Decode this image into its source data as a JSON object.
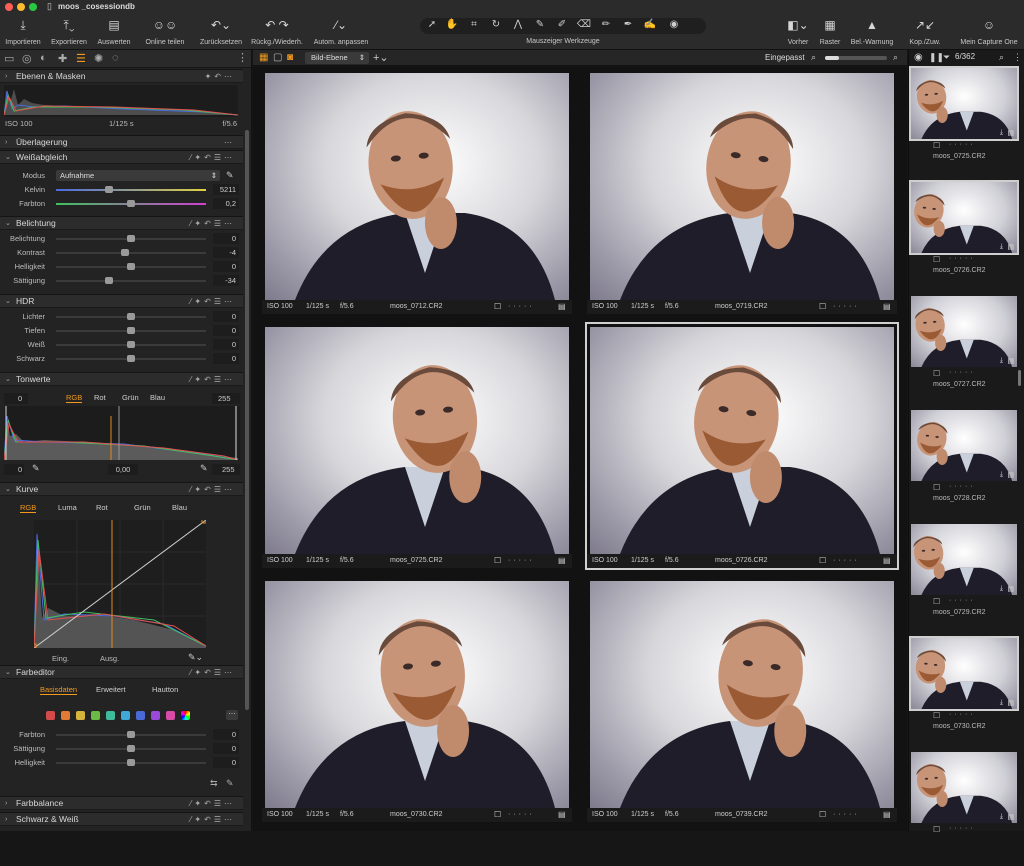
{
  "window": {
    "title": "moos _cosessiondb"
  },
  "toolbar": {
    "import": "Importieren",
    "export": "Exportieren",
    "evaluate": "Auswerten",
    "share": "Online teilen",
    "reset": "Zurücksetzen",
    "undo": "Rückg./Wiederh.",
    "auto": "Autom. anpassen",
    "cursor_tools": "Mauszeiger Werkzeuge",
    "before": "Vorher",
    "grid": "Raster",
    "exposure_warning": "Bel.-Warnung",
    "copy": "Kop./Zuw.",
    "my_capture": "Mein Capture One"
  },
  "left": {
    "layers": {
      "title": "Ebenen & Masken"
    },
    "histogram": {
      "iso": "ISO 100",
      "shutter": "1/125 s",
      "aperture": "f/5.6"
    },
    "overlay": {
      "title": "Überlagerung"
    },
    "wb": {
      "title": "Weißabgleich",
      "mode_label": "Modus",
      "mode_value": "Aufnahme",
      "kelvin_label": "Kelvin",
      "kelvin_value": "5211",
      "tint_label": "Farbton",
      "tint_value": "0,2",
      "kelvin_pos": 0.35,
      "tint_pos": 0.5
    },
    "exposure": {
      "title": "Belichtung",
      "rows": [
        {
          "label": "Belichtung",
          "value": "0",
          "pos": 0.5
        },
        {
          "label": "Kontrast",
          "value": "-4",
          "pos": 0.46
        },
        {
          "label": "Helligkeit",
          "value": "0",
          "pos": 0.5
        },
        {
          "label": "Sättigung",
          "value": "-34",
          "pos": 0.35
        }
      ]
    },
    "hdr": {
      "title": "HDR",
      "rows": [
        {
          "label": "Lichter",
          "value": "0",
          "pos": 0.5
        },
        {
          "label": "Tiefen",
          "value": "0",
          "pos": 0.5
        },
        {
          "label": "Weiß",
          "value": "0",
          "pos": 0.5
        },
        {
          "label": "Schwarz",
          "value": "0",
          "pos": 0.5
        }
      ]
    },
    "levels": {
      "title": "Tonwerte",
      "low": "0",
      "high": "255",
      "mid": "0,00",
      "channels": [
        "RGB",
        "Rot",
        "Grün",
        "Blau"
      ],
      "active_channel": "RGB",
      "out_low": "0",
      "out_high": "255"
    },
    "curve": {
      "title": "Kurve",
      "channels": [
        "RGB",
        "Luma",
        "Rot",
        "Grün",
        "Blau"
      ],
      "input_label": "Eing.",
      "output_label": "Ausg."
    },
    "color_editor": {
      "title": "Farbeditor",
      "tabs": [
        "Basisdaten",
        "Erweitert",
        "Hautton"
      ],
      "active_tab": "Basisdaten",
      "swatches": [
        "#d44a4a",
        "#e07a35",
        "#d4b43a",
        "#6cba45",
        "#3fba9a",
        "#3fa8d8",
        "#4a6ad8",
        "#9a4ad8",
        "#d84aa8"
      ],
      "rows": [
        {
          "label": "Farbton",
          "value": "0",
          "pos": 0.5
        },
        {
          "label": "Sättigung",
          "value": "0",
          "pos": 0.5
        },
        {
          "label": "Helligkeit",
          "value": "0",
          "pos": 0.5
        }
      ]
    },
    "color_balance": {
      "title": "Farbbalance"
    },
    "bw": {
      "title": "Schwarz & Weiß"
    }
  },
  "center": {
    "layer_select": "Bild-Ebene",
    "zoom": "Eingepasst",
    "images": [
      {
        "iso": "ISO 100",
        "shutter": "1/125 s",
        "aperture": "f/5.6",
        "name": "moos_0712.CR2",
        "selected": false
      },
      {
        "iso": "ISO 100",
        "shutter": "1/125 s",
        "aperture": "f/5.6",
        "name": "moos_0719.CR2",
        "selected": false
      },
      {
        "iso": "ISO 100",
        "shutter": "1/125 s",
        "aperture": "f/5.6",
        "name": "moos_0725.CR2",
        "selected": false
      },
      {
        "iso": "ISO 100",
        "shutter": "1/125 s",
        "aperture": "f/5.6",
        "name": "moos_0726.CR2",
        "selected": true
      },
      {
        "iso": "ISO 100",
        "shutter": "1/125 s",
        "aperture": "f/5.6",
        "name": "moos_0730.CR2",
        "selected": false
      },
      {
        "iso": "ISO 100",
        "shutter": "1/125 s",
        "aperture": "f/5.6",
        "name": "moos_0739.CR2",
        "selected": false
      }
    ]
  },
  "browser": {
    "count": "6/362",
    "thumbs": [
      {
        "name": "moos_0725.CR2",
        "selected": true
      },
      {
        "name": "moos_0726.CR2",
        "selected": true
      },
      {
        "name": "moos_0727.CR2",
        "selected": false
      },
      {
        "name": "moos_0728.CR2",
        "selected": false
      },
      {
        "name": "moos_0729.CR2",
        "selected": false
      },
      {
        "name": "moos_0730.CR2",
        "selected": true
      },
      {
        "name": "",
        "selected": false
      }
    ]
  }
}
